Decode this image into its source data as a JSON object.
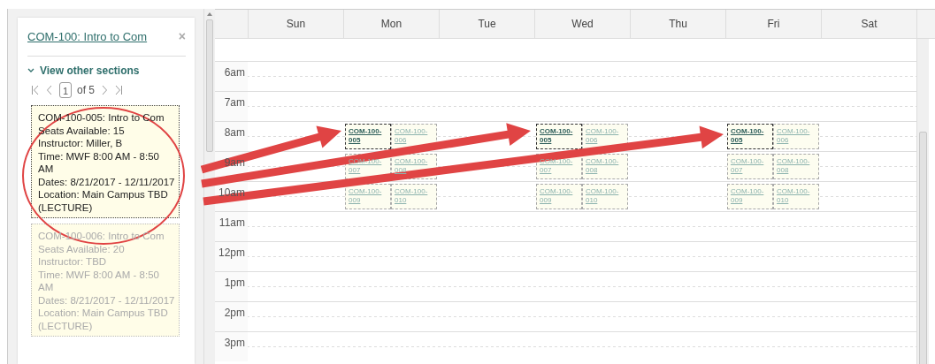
{
  "course_panel": {
    "title": "COM-100: Intro to Com",
    "close": "×",
    "toggle": {
      "label": "View other sections",
      "expanded": true
    },
    "pager": {
      "page": "1",
      "of": "of 5"
    },
    "sections": [
      {
        "selected": true,
        "lines": [
          "COM-100-005: Intro to Com",
          "Seats Available: 15",
          "Instructor: Miller, B",
          "Time: MWF 8:00 AM - 8:50 AM",
          "Dates: 8/21/2017 - 12/11/2017",
          "Location: Main Campus TBD (LECTURE)"
        ]
      },
      {
        "selected": false,
        "lines": [
          "COM-100-006: Intro to Com",
          "Seats Available: 20",
          "Instructor: TBD",
          "Time: MWF 8:00 AM - 8:50 AM",
          "Dates: 8/21/2017 - 12/11/2017",
          "Location: Main Campus TBD (LECTURE)"
        ]
      }
    ]
  },
  "calendar": {
    "days": [
      "Sun",
      "Mon",
      "Tue",
      "Wed",
      "Thu",
      "Fri",
      "Sat"
    ],
    "rows": [
      {
        "label": "6am"
      },
      {
        "label": "7am"
      },
      {
        "label": "8am",
        "cells": [
          {},
          {
            "events": [
              {
                "label": "COM-100-005",
                "selected": true
              },
              {
                "label": "COM-100-006",
                "selected": false
              }
            ]
          },
          {},
          {
            "events": [
              {
                "label": "COM-100-005",
                "selected": true
              },
              {
                "label": "COM-100-006",
                "selected": false
              }
            ]
          },
          {},
          {
            "events": [
              {
                "label": "COM-100-005",
                "selected": true
              },
              {
                "label": "COM-100-006",
                "selected": false
              }
            ]
          },
          {}
        ]
      },
      {
        "label": "9am",
        "cells": [
          {},
          {
            "events": [
              {
                "label": "COM-100-007",
                "selected": false
              },
              {
                "label": "COM-100-008",
                "selected": false
              }
            ]
          },
          {},
          {
            "events": [
              {
                "label": "COM-100-007",
                "selected": false
              },
              {
                "label": "COM-100-008",
                "selected": false
              }
            ]
          },
          {},
          {
            "events": [
              {
                "label": "COM-100-007",
                "selected": false
              },
              {
                "label": "COM-100-008",
                "selected": false
              }
            ]
          },
          {}
        ]
      },
      {
        "label": "10am",
        "cells": [
          {},
          {
            "events": [
              {
                "label": "COM-100-009",
                "selected": false
              },
              {
                "label": "COM-100-010",
                "selected": false
              }
            ]
          },
          {},
          {
            "events": [
              {
                "label": "COM-100-009",
                "selected": false
              },
              {
                "label": "COM-100-010",
                "selected": false
              }
            ]
          },
          {},
          {
            "events": [
              {
                "label": "COM-100-009",
                "selected": false
              },
              {
                "label": "COM-100-010",
                "selected": false
              }
            ]
          },
          {}
        ]
      },
      {
        "label": "11am"
      },
      {
        "label": "12pm"
      },
      {
        "label": "1pm"
      },
      {
        "label": "2pm"
      },
      {
        "label": "3pm"
      }
    ]
  }
}
